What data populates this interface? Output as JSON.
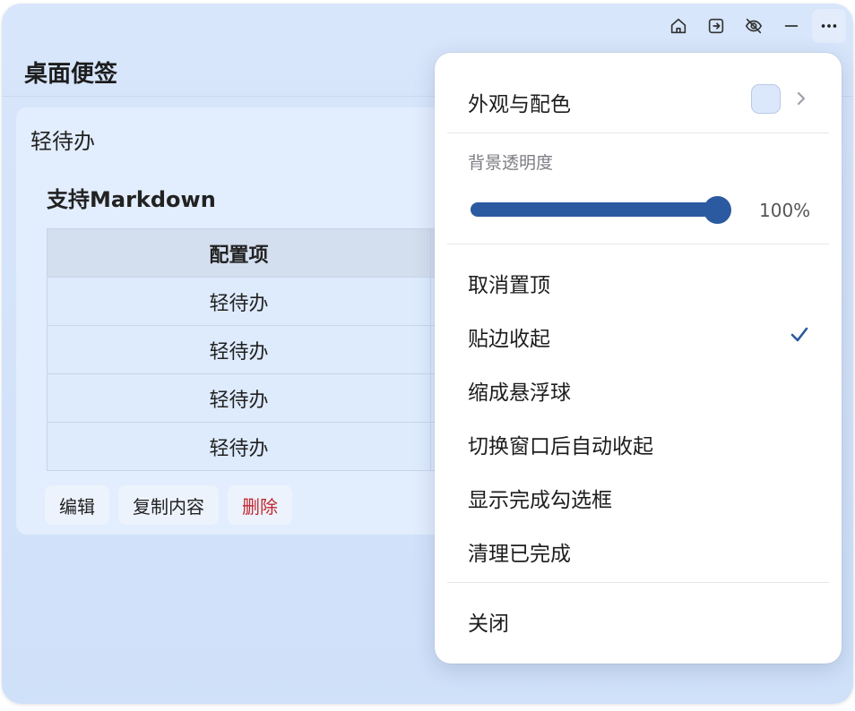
{
  "toolbar": {
    "icons": [
      "home-icon",
      "exit-icon",
      "eye-off-icon",
      "minimize-icon",
      "more-icon"
    ]
  },
  "app": {
    "title": "桌面便签"
  },
  "note": {
    "title": "轻待办",
    "markdown_heading": "支持Markdown",
    "table": {
      "header": "配置项",
      "rows": [
        "轻待办",
        "轻待办",
        "轻待办",
        "轻待办"
      ]
    },
    "actions": {
      "edit": "编辑",
      "copy": "复制内容",
      "delete": "删除"
    }
  },
  "menu": {
    "appearance_label": "外观与配色",
    "appearance_color": "#dbe7fb",
    "opacity_label": "背景透明度",
    "opacity_value": 100,
    "opacity_text": "100%",
    "items": [
      {
        "label": "取消置顶",
        "checked": false
      },
      {
        "label": "贴边收起",
        "checked": true
      },
      {
        "label": "缩成悬浮球",
        "checked": false
      },
      {
        "label": "切换窗口后自动收起",
        "checked": false
      },
      {
        "label": "显示完成勾选框",
        "checked": false
      },
      {
        "label": "清理已完成",
        "checked": false
      }
    ],
    "close_label": "关闭"
  },
  "colors": {
    "accent": "#2b5aa0",
    "danger": "#c0282e"
  }
}
